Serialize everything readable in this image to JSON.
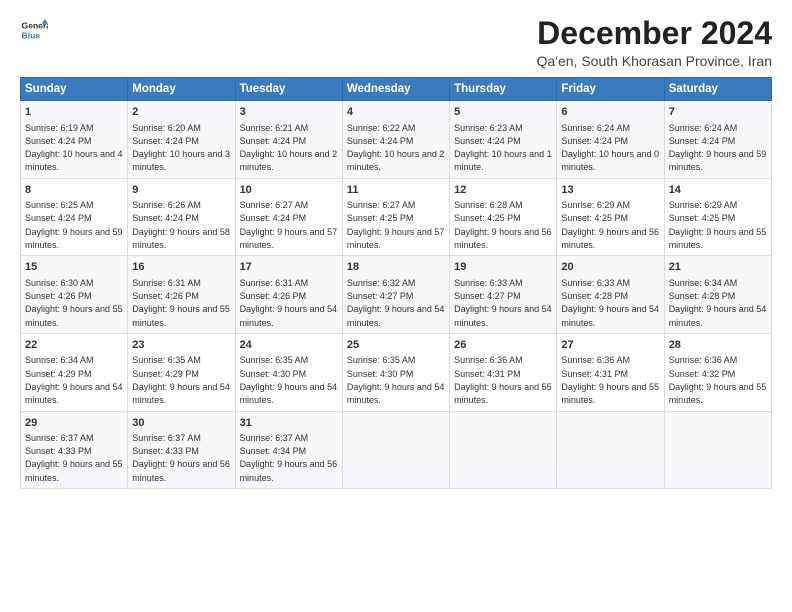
{
  "header": {
    "logo_line1": "General",
    "logo_line2": "Blue",
    "main_title": "December 2024",
    "subtitle": "Qa'en, South Khorasan Province, Iran"
  },
  "days_of_week": [
    "Sunday",
    "Monday",
    "Tuesday",
    "Wednesday",
    "Thursday",
    "Friday",
    "Saturday"
  ],
  "weeks": [
    [
      {
        "day": 1,
        "sunrise": "6:19 AM",
        "sunset": "4:24 PM",
        "daylight": "10 hours and 4 minutes."
      },
      {
        "day": 2,
        "sunrise": "6:20 AM",
        "sunset": "4:24 PM",
        "daylight": "10 hours and 3 minutes."
      },
      {
        "day": 3,
        "sunrise": "6:21 AM",
        "sunset": "4:24 PM",
        "daylight": "10 hours and 2 minutes."
      },
      {
        "day": 4,
        "sunrise": "6:22 AM",
        "sunset": "4:24 PM",
        "daylight": "10 hours and 2 minutes."
      },
      {
        "day": 5,
        "sunrise": "6:23 AM",
        "sunset": "4:24 PM",
        "daylight": "10 hours and 1 minute."
      },
      {
        "day": 6,
        "sunrise": "6:24 AM",
        "sunset": "4:24 PM",
        "daylight": "10 hours and 0 minutes."
      },
      {
        "day": 7,
        "sunrise": "6:24 AM",
        "sunset": "4:24 PM",
        "daylight": "9 hours and 59 minutes."
      }
    ],
    [
      {
        "day": 8,
        "sunrise": "6:25 AM",
        "sunset": "4:24 PM",
        "daylight": "9 hours and 59 minutes."
      },
      {
        "day": 9,
        "sunrise": "6:26 AM",
        "sunset": "4:24 PM",
        "daylight": "9 hours and 58 minutes."
      },
      {
        "day": 10,
        "sunrise": "6:27 AM",
        "sunset": "4:24 PM",
        "daylight": "9 hours and 57 minutes."
      },
      {
        "day": 11,
        "sunrise": "6:27 AM",
        "sunset": "4:25 PM",
        "daylight": "9 hours and 57 minutes."
      },
      {
        "day": 12,
        "sunrise": "6:28 AM",
        "sunset": "4:25 PM",
        "daylight": "9 hours and 56 minutes."
      },
      {
        "day": 13,
        "sunrise": "6:29 AM",
        "sunset": "4:25 PM",
        "daylight": "9 hours and 56 minutes."
      },
      {
        "day": 14,
        "sunrise": "6:29 AM",
        "sunset": "4:25 PM",
        "daylight": "9 hours and 55 minutes."
      }
    ],
    [
      {
        "day": 15,
        "sunrise": "6:30 AM",
        "sunset": "4:26 PM",
        "daylight": "9 hours and 55 minutes."
      },
      {
        "day": 16,
        "sunrise": "6:31 AM",
        "sunset": "4:26 PM",
        "daylight": "9 hours and 55 minutes."
      },
      {
        "day": 17,
        "sunrise": "6:31 AM",
        "sunset": "4:26 PM",
        "daylight": "9 hours and 54 minutes."
      },
      {
        "day": 18,
        "sunrise": "6:32 AM",
        "sunset": "4:27 PM",
        "daylight": "9 hours and 54 minutes."
      },
      {
        "day": 19,
        "sunrise": "6:33 AM",
        "sunset": "4:27 PM",
        "daylight": "9 hours and 54 minutes."
      },
      {
        "day": 20,
        "sunrise": "6:33 AM",
        "sunset": "4:28 PM",
        "daylight": "9 hours and 54 minutes."
      },
      {
        "day": 21,
        "sunrise": "6:34 AM",
        "sunset": "4:28 PM",
        "daylight": "9 hours and 54 minutes."
      }
    ],
    [
      {
        "day": 22,
        "sunrise": "6:34 AM",
        "sunset": "4:29 PM",
        "daylight": "9 hours and 54 minutes."
      },
      {
        "day": 23,
        "sunrise": "6:35 AM",
        "sunset": "4:29 PM",
        "daylight": "9 hours and 54 minutes."
      },
      {
        "day": 24,
        "sunrise": "6:35 AM",
        "sunset": "4:30 PM",
        "daylight": "9 hours and 54 minutes."
      },
      {
        "day": 25,
        "sunrise": "6:35 AM",
        "sunset": "4:30 PM",
        "daylight": "9 hours and 54 minutes."
      },
      {
        "day": 26,
        "sunrise": "6:36 AM",
        "sunset": "4:31 PM",
        "daylight": "9 hours and 55 minutes."
      },
      {
        "day": 27,
        "sunrise": "6:36 AM",
        "sunset": "4:31 PM",
        "daylight": "9 hours and 55 minutes."
      },
      {
        "day": 28,
        "sunrise": "6:36 AM",
        "sunset": "4:32 PM",
        "daylight": "9 hours and 55 minutes."
      }
    ],
    [
      {
        "day": 29,
        "sunrise": "6:37 AM",
        "sunset": "4:33 PM",
        "daylight": "9 hours and 55 minutes."
      },
      {
        "day": 30,
        "sunrise": "6:37 AM",
        "sunset": "4:33 PM",
        "daylight": "9 hours and 56 minutes."
      },
      {
        "day": 31,
        "sunrise": "6:37 AM",
        "sunset": "4:34 PM",
        "daylight": "9 hours and 56 minutes."
      },
      null,
      null,
      null,
      null
    ]
  ]
}
